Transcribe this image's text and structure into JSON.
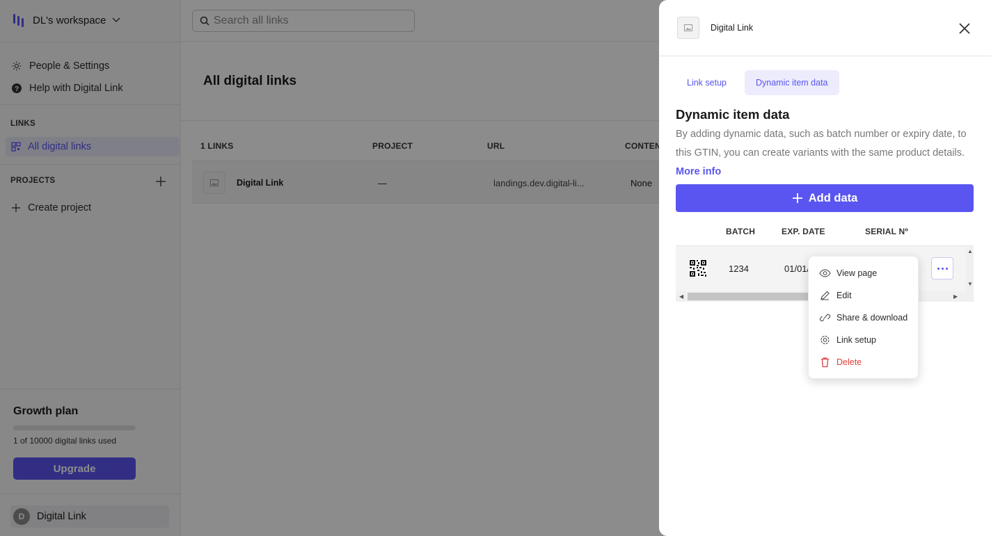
{
  "workspace": {
    "name": "DL's workspace"
  },
  "sidebar": {
    "items": [
      {
        "label": "People & Settings"
      },
      {
        "label": "Help with Digital Link"
      }
    ],
    "links_heading": "LINKS",
    "all_links_label": "All digital links",
    "projects_heading": "PROJECTS",
    "create_project_label": "Create project"
  },
  "plan": {
    "title": "Growth plan",
    "usage_text": "1 of 10000 digital links used",
    "usage_fraction": 0.0001,
    "upgrade_label": "Upgrade"
  },
  "user": {
    "initial": "D",
    "name": "Digital Link"
  },
  "search": {
    "placeholder": "Search all links"
  },
  "main": {
    "title": "All digital links",
    "columns": [
      "1 LINKS",
      "PROJECT",
      "URL",
      "CONTEN"
    ],
    "rows": [
      {
        "name": "Digital Link",
        "project": "—",
        "url": "landings.dev.digital-li...",
        "content": "None"
      }
    ]
  },
  "drawer": {
    "title": "Digital Link",
    "tabs": [
      {
        "label": "Link setup",
        "active": false
      },
      {
        "label": "Dynamic item data",
        "active": true
      }
    ],
    "heading": "Dynamic item data",
    "description": "By adding dynamic data, such as batch number or expiry date, to this GTIN, you can create variants with the same product details.",
    "more_info_label": "More info",
    "add_button_label": "Add data",
    "table": {
      "columns": [
        "BATCH",
        "EXP. DATE",
        "SERIAL Nº"
      ],
      "rows": [
        {
          "batch": "1234",
          "exp_date": "01/01/"
        }
      ]
    }
  },
  "context_menu": {
    "items": [
      {
        "label": "View page",
        "icon": "eye-icon"
      },
      {
        "label": "Edit",
        "icon": "pencil-icon"
      },
      {
        "label": "Share & download",
        "icon": "link-icon"
      },
      {
        "label": "Link setup",
        "icon": "gear-icon"
      },
      {
        "label": "Delete",
        "icon": "trash-icon"
      }
    ]
  },
  "colors": {
    "accent": "#5a55f0",
    "danger": "#e03c3c",
    "overlay": "rgba(0,0,0,0.45)"
  }
}
